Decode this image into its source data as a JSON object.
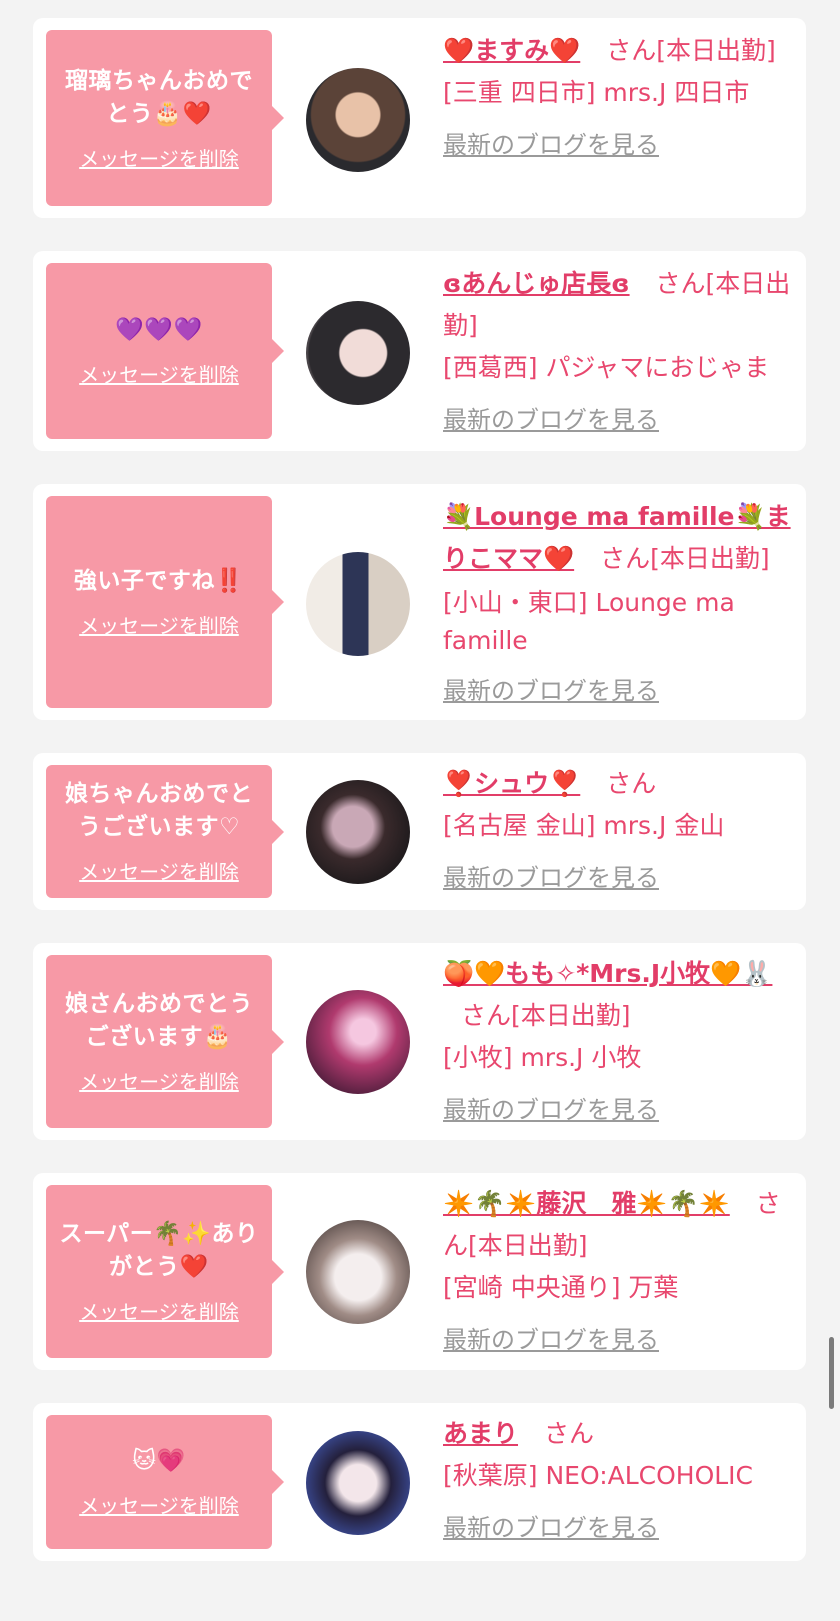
{
  "delete_label": "メッセージを削除",
  "blog_label": "最新のブログを見る",
  "san": "さん",
  "colors": {
    "bubble": "#f799a6",
    "name": "#e23d68",
    "text": "#e8476e",
    "link_gray": "#9a9a9a",
    "card": "#ffffff",
    "page_bg": "#f3f3f3"
  },
  "cards": [
    {
      "message": "瑠璃ちゃんおめでとう🎂❤️",
      "name": "❤️ますみ❤️",
      "status": "[本日出勤]",
      "shop": "[三重 四日市] mrs.J 四日市",
      "avatar_icon": "avatar-photo"
    },
    {
      "message": "💜💜💜",
      "name": "ɞあんじゅ店長ɞ",
      "status": "[本日出勤]",
      "shop": "[西葛西] パジャマにおじゃま",
      "avatar_icon": "avatar-photo"
    },
    {
      "message": "強い子ですね‼️",
      "name": "💐Lounge ma famille💐まりこママ❤️",
      "status": "[本日出勤]",
      "shop": "[小山・東口] Lounge ma famille",
      "avatar_icon": "avatar-photo"
    },
    {
      "message": "娘ちゃんおめでとうございます♡",
      "name": "❣️シュウ❣️",
      "status": "",
      "shop": "[名古屋 金山] mrs.J 金山",
      "avatar_icon": "avatar-photo"
    },
    {
      "message": "娘さんおめでとうございます🎂",
      "name": "🍑🧡もも✧*Mrs.J小牧🧡🐰",
      "status": "[本日出勤]",
      "shop": "[小牧] mrs.J 小牧",
      "avatar_icon": "avatar-photo"
    },
    {
      "message": "スーパー🌴✨ありがとう❤️",
      "name": "✴️🌴✴️藤沢　雅✴️🌴✴️",
      "status": "[本日出勤]",
      "shop": "[宮崎 中央通り] 万葉",
      "avatar_icon": "avatar-photo"
    },
    {
      "message": "🐱💗",
      "name": "あまり",
      "status": "",
      "shop": "[秋葉原] NEO:ALCOHOLIC",
      "avatar_icon": "avatar-photo"
    }
  ]
}
